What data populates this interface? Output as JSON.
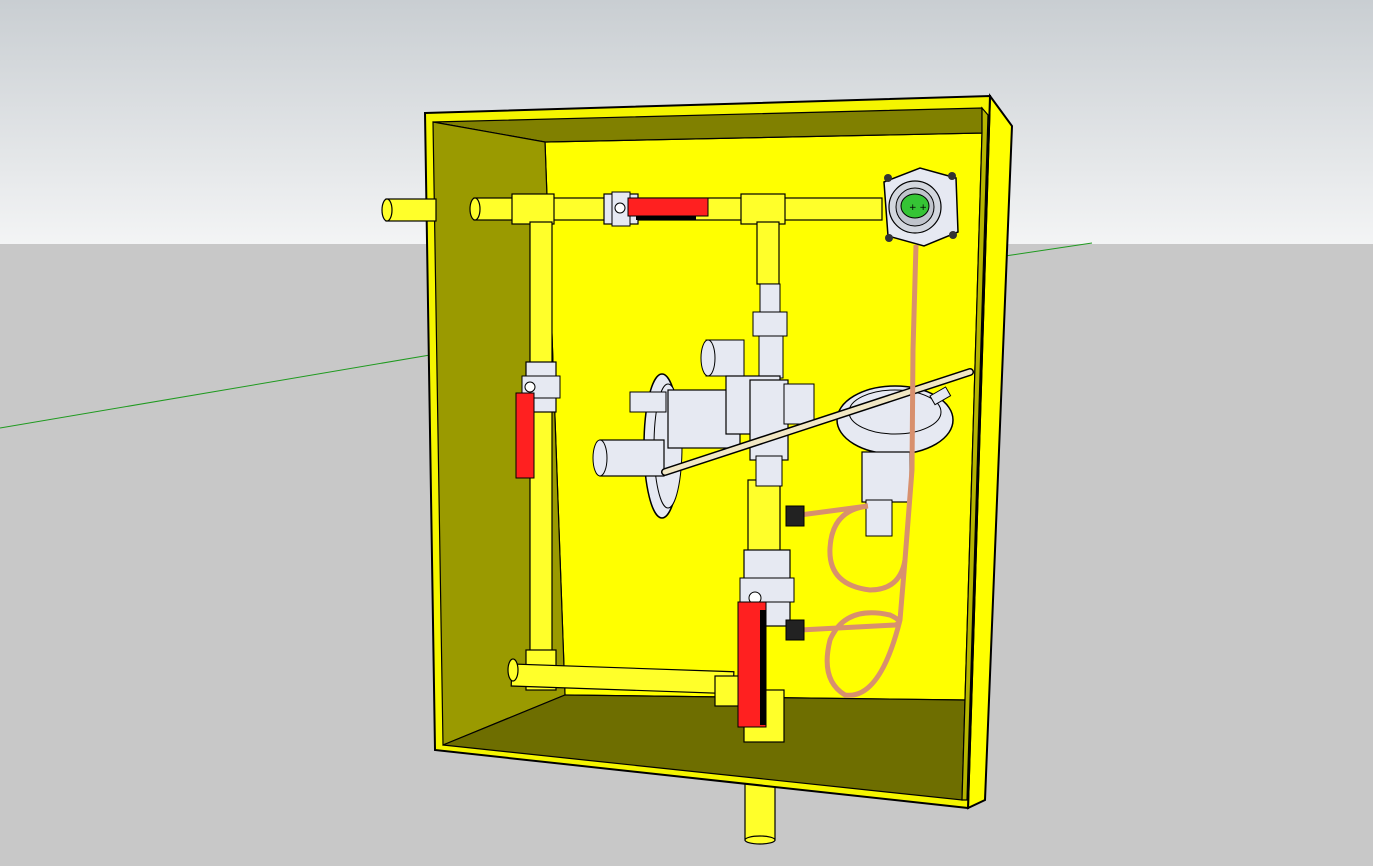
{
  "viewport": {
    "sky_color_top": "#c9ced2",
    "sky_color_bottom": "#f3f4f5",
    "ground_color": "#c8c8c8",
    "axis_green": "#1f9a1f"
  },
  "model": {
    "cabinet": {
      "face_color": "#ffff00",
      "outer_edge_color": "#f5f500",
      "shade_dark": "#808000",
      "shade_mid": "#9a9a00",
      "shade_light": "#b5b500",
      "shade_deep": "#6e6e00"
    },
    "pipe_color": "#ffff2a",
    "valve_handle_color": "#ff2020",
    "copper_line_color": "#d8906e",
    "regulator_color": "#e6e9f2",
    "gauge_window_color": "#35c435",
    "valves": [
      {
        "icon": "ball-valve-icon",
        "orientation": "horizontal",
        "position": "top"
      },
      {
        "icon": "ball-valve-icon",
        "orientation": "vertical",
        "position": "left"
      },
      {
        "icon": "ball-valve-icon",
        "orientation": "vertical",
        "position": "bottom"
      }
    ],
    "regulators": [
      {
        "icon": "gas-regulator-icon",
        "position": "left"
      },
      {
        "icon": "gas-regulator-icon",
        "position": "right"
      }
    ],
    "gauge": {
      "icon": "pressure-gauge-icon"
    }
  }
}
